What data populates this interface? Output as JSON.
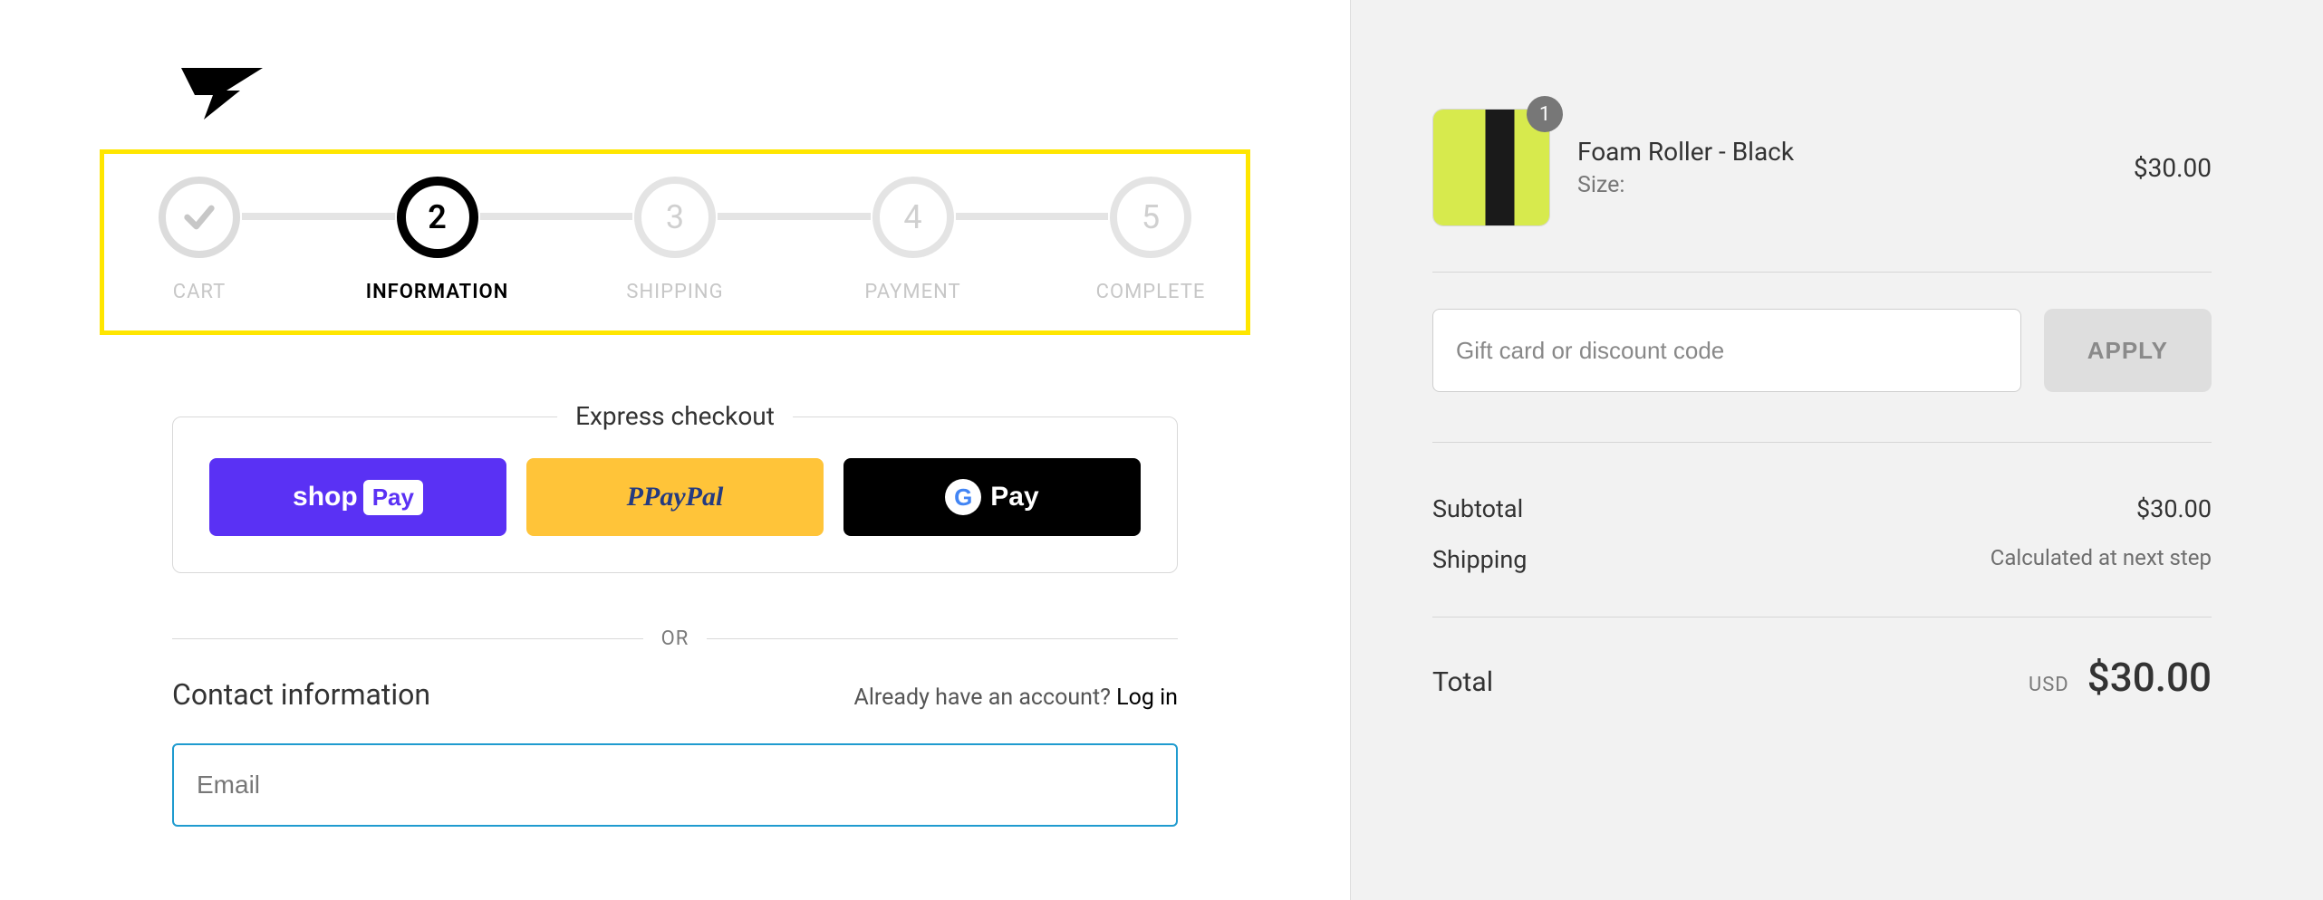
{
  "steps": [
    {
      "label": "CART",
      "state": "completed",
      "marker": "✓"
    },
    {
      "label": "INFORMATION",
      "state": "current",
      "marker": "2"
    },
    {
      "label": "SHIPPING",
      "state": "future",
      "marker": "3"
    },
    {
      "label": "PAYMENT",
      "state": "future",
      "marker": "4"
    },
    {
      "label": "COMPLETE",
      "state": "future",
      "marker": "5"
    }
  ],
  "express": {
    "title": "Express checkout",
    "shoppay_text": "shop",
    "shoppay_badge": "Pay",
    "paypal_prefix": "P ",
    "paypal_text": "PayPal",
    "gpay_g": "G",
    "gpay_text": "Pay"
  },
  "divider": {
    "or": "OR"
  },
  "contact": {
    "heading": "Contact information",
    "already_text": "Already have an account? ",
    "login_text": "Log in",
    "email_placeholder": "Email"
  },
  "summary": {
    "item": {
      "title": "Foam Roller - Black",
      "subtitle": "Size:",
      "price": "$30.00",
      "qty": "1"
    },
    "discount": {
      "placeholder": "Gift card or discount code",
      "apply_label": "APPLY"
    },
    "subtotal_label": "Subtotal",
    "subtotal_value": "$30.00",
    "shipping_label": "Shipping",
    "shipping_value": "Calculated at next step",
    "total_label": "Total",
    "total_currency": "USD",
    "total_value": "$30.00"
  }
}
